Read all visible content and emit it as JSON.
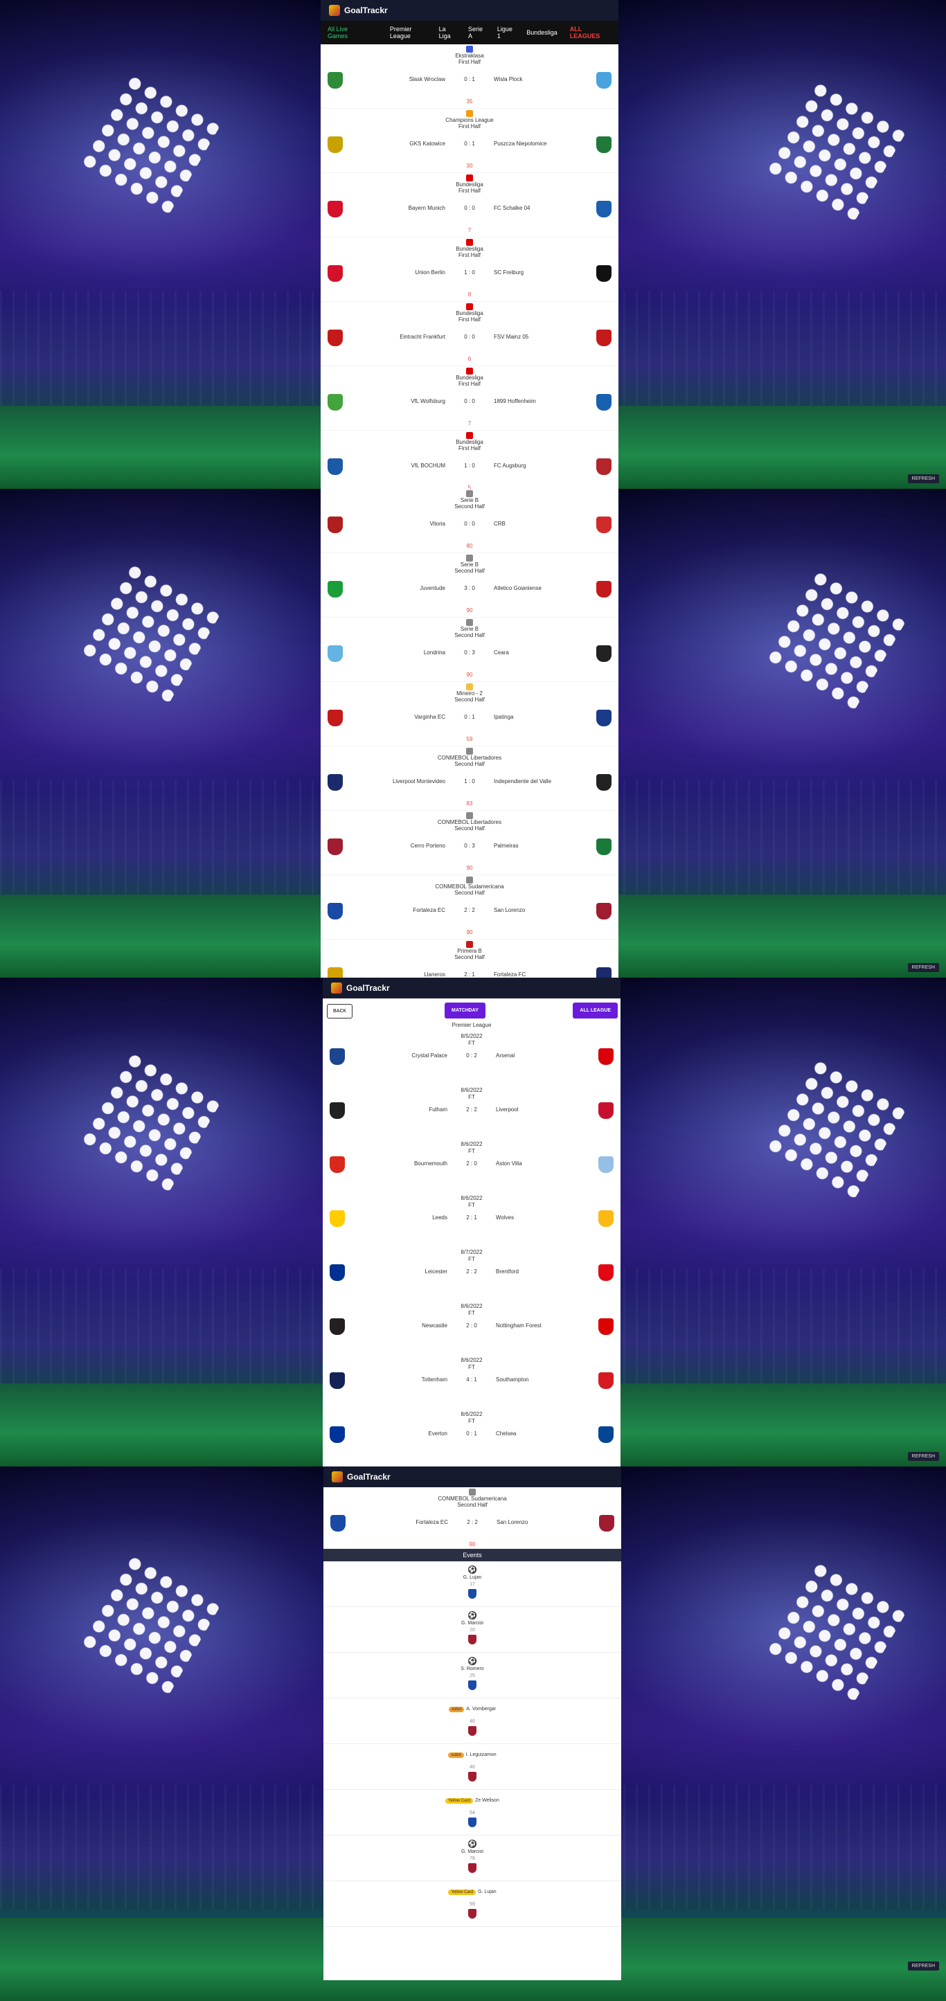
{
  "app": {
    "title": "GoalTrackr",
    "refresh": "REFRESH"
  },
  "nav": {
    "live": "All Live Games",
    "leagues": [
      "Premier League",
      "La Liga",
      "Serie A",
      "Ligue 1",
      "Bundesliga"
    ],
    "all": "ALL LEAGUES"
  },
  "screen1": {
    "matches": [
      {
        "league": "Ekstraklasa",
        "status": "First Half",
        "home": "Slask Wroclaw",
        "score": "0 : 1",
        "away": "Wisla Plock",
        "minute": "35",
        "home_color": "#2e8b3a",
        "away_color": "#4aa3df",
        "icon_color": "#3b5bdb"
      },
      {
        "league": "Champions League",
        "status": "First Half",
        "home": "GKS Katowice",
        "score": "0 : 1",
        "away": "Puszcza Niepolomice",
        "minute": "30",
        "home_color": "#c8a200",
        "away_color": "#1f7a3a",
        "icon_color": "#f39c12"
      },
      {
        "league": "Bundesliga",
        "status": "First Half",
        "home": "Bayern Munich",
        "score": "0 : 0",
        "away": "FC Schalke 04",
        "minute": "7",
        "home_color": "#d4102a",
        "away_color": "#1b5fae",
        "icon_color": "#d00"
      },
      {
        "league": "Bundesliga",
        "status": "First Half",
        "home": "Union Berlin",
        "score": "1 : 0",
        "away": "SC Freiburg",
        "minute": "8",
        "home_color": "#d4102a",
        "away_color": "#111111",
        "icon_color": "#d00"
      },
      {
        "league": "Bundesliga",
        "status": "First Half",
        "home": "Eintracht Frankfurt",
        "score": "0 : 0",
        "away": "FSV Mainz 05",
        "minute": "6",
        "home_color": "#c41a1a",
        "away_color": "#c41a1a",
        "icon_color": "#d00"
      },
      {
        "league": "Bundesliga",
        "status": "First Half",
        "home": "VfL Wolfsburg",
        "score": "0 : 0",
        "away": "1899 Hoffenheim",
        "minute": "7",
        "home_color": "#43a33c",
        "away_color": "#1761b0",
        "icon_color": "#d00"
      },
      {
        "league": "Bundesliga",
        "status": "First Half",
        "home": "VfL BOCHUM",
        "score": "1 : 0",
        "away": "FC Augsburg",
        "minute": "5",
        "home_color": "#1a5aa6",
        "away_color": "#b3242b",
        "icon_color": "#d00"
      }
    ]
  },
  "screen2": {
    "matches": [
      {
        "league": "Serie B",
        "status": "Second Half",
        "home": "Vitoria",
        "score": "0 : 0",
        "away": "CRB",
        "minute": "80",
        "home_color": "#b01f1f",
        "away_color": "#d12a2a",
        "icon_color": "#888"
      },
      {
        "league": "Serie B",
        "status": "Second Half",
        "home": "Juventude",
        "score": "3 : 0",
        "away": "Atletico Goianiense",
        "minute": "90",
        "home_color": "#1a9e3a",
        "away_color": "#c41a1a",
        "icon_color": "#888"
      },
      {
        "league": "Serie B",
        "status": "Second Half",
        "home": "Londrina",
        "score": "0 : 3",
        "away": "Ceara",
        "minute": "90",
        "home_color": "#63b3e3",
        "away_color": "#222222",
        "icon_color": "#888"
      },
      {
        "league": "Mineiro - 2",
        "status": "Second Half",
        "home": "Varginha EC",
        "score": "0 : 1",
        "away": "Ipatinga",
        "minute": "59",
        "home_color": "#c41a1a",
        "away_color": "#1a3a8a",
        "icon_color": "#f0c040"
      },
      {
        "league": "CONMEBOL Libertadores",
        "status": "Second Half",
        "home": "Liverpool Montevideo",
        "score": "1 : 0",
        "away": "Independiente del Valle",
        "minute": "83",
        "home_color": "#1a2a6a",
        "away_color": "#222222",
        "icon_color": "#888"
      },
      {
        "league": "CONMEBOL Libertadores",
        "status": "Second Half",
        "home": "Cerro Porteno",
        "score": "0 : 3",
        "away": "Palmeiras",
        "minute": "90",
        "home_color": "#a01c30",
        "away_color": "#1a7a3a",
        "icon_color": "#888"
      },
      {
        "league": "CONMEBOL Sudamericana",
        "status": "Second Half",
        "home": "Fortaleza EC",
        "score": "2 : 2",
        "away": "San Lorenzo",
        "minute": "90",
        "home_color": "#1a4aa6",
        "away_color": "#a01c30",
        "icon_color": "#888"
      },
      {
        "league": "Primera B",
        "status": "Second Half",
        "home": "Llaneros",
        "score": "2 : 1",
        "away": "Fortaleza FC",
        "minute": "",
        "home_color": "#d4a200",
        "away_color": "#1a2a6a",
        "icon_color": "#c41a1a"
      }
    ]
  },
  "screen3": {
    "back": "BACK",
    "matchday": "MATCHDAY",
    "all_league": "ALL LEAGUE",
    "league": "Premier League",
    "fixtures": [
      {
        "date": "8/5/2022",
        "status": "FT",
        "home": "Crystal Palace",
        "score": "0 : 2",
        "away": "Arsenal",
        "home_color": "#1b458f",
        "away_color": "#db0007"
      },
      {
        "date": "8/6/2022",
        "status": "FT",
        "home": "Fulham",
        "score": "2 : 2",
        "away": "Liverpool",
        "home_color": "#222222",
        "away_color": "#c8102e"
      },
      {
        "date": "8/6/2022",
        "status": "FT",
        "home": "Bournemouth",
        "score": "2 : 0",
        "away": "Aston Villa",
        "home_color": "#da291c",
        "away_color": "#95bfe5"
      },
      {
        "date": "8/6/2022",
        "status": "FT",
        "home": "Leeds",
        "score": "2 : 1",
        "away": "Wolves",
        "home_color": "#ffcd00",
        "away_color": "#fdb913"
      },
      {
        "date": "8/7/2022",
        "status": "FT",
        "home": "Leicester",
        "score": "2 : 2",
        "away": "Brentford",
        "home_color": "#003090",
        "away_color": "#e30613"
      },
      {
        "date": "8/6/2022",
        "status": "FT",
        "home": "Newcastle",
        "score": "2 : 0",
        "away": "Nottingham Forest",
        "home_color": "#241f20",
        "away_color": "#dd0000"
      },
      {
        "date": "8/6/2022",
        "status": "FT",
        "home": "Tottenham",
        "score": "4 : 1",
        "away": "Southampton",
        "home_color": "#132257",
        "away_color": "#d71920"
      },
      {
        "date": "8/6/2022",
        "status": "FT",
        "home": "Everton",
        "score": "0 : 1",
        "away": "Chelsea",
        "home_color": "#003399",
        "away_color": "#034694"
      }
    ]
  },
  "screen4": {
    "match": {
      "league": "CONMEBOL Sudamericana",
      "status": "Second Half",
      "home": "Fortaleza EC",
      "score": "2 : 2",
      "away": "San Lorenzo",
      "minute": "90",
      "home_color": "#1a4aa6",
      "away_color": "#a01c30"
    },
    "events_title": "Events",
    "events": [
      {
        "type": "goal",
        "tag": "",
        "name": "G. Lujan",
        "minute": "17",
        "team_color": "#1a4aa6"
      },
      {
        "type": "goal",
        "tag": "",
        "name": "G. Marcioi",
        "minute": "20",
        "team_color": "#a01c30"
      },
      {
        "type": "goal",
        "tag": "",
        "name": "S. Romero",
        "minute": "25",
        "team_color": "#1a4aa6"
      },
      {
        "type": "subst",
        "tag": "subst",
        "name": "A. Vombergar",
        "minute": "46",
        "team_color": "#a01c30"
      },
      {
        "type": "subst",
        "tag": "subst",
        "name": "I. Leguizamon",
        "minute": "46",
        "team_color": "#a01c30"
      },
      {
        "type": "card",
        "tag": "Yellow Card",
        "name": "Ze Welison",
        "minute": "54",
        "team_color": "#1a4aa6"
      },
      {
        "type": "goal",
        "tag": "",
        "name": "G. Marcioi",
        "minute": "78",
        "team_color": "#a01c30"
      },
      {
        "type": "card",
        "tag": "Yellow Card",
        "name": "G. Lujan",
        "minute": "59",
        "team_color": "#a01c30"
      }
    ]
  }
}
